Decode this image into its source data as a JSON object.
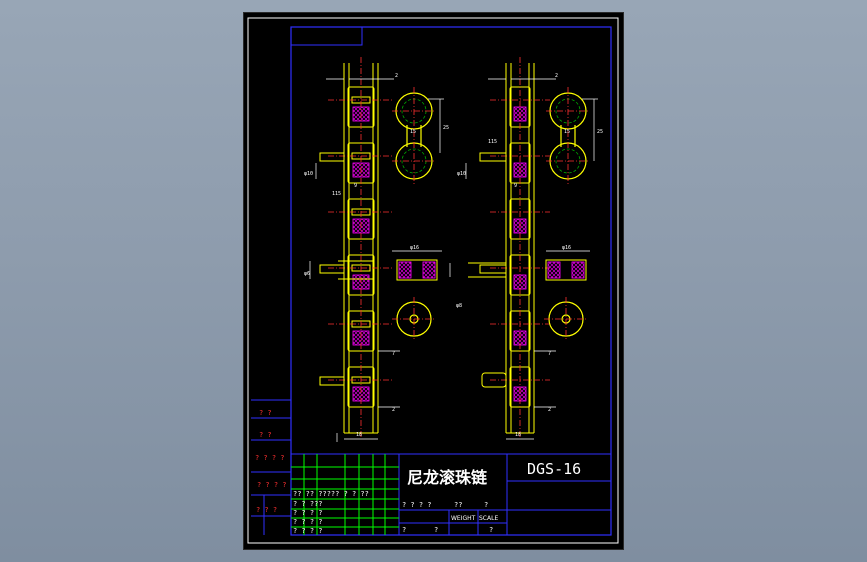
{
  "title_block": {
    "part_name": "尼龙滚珠链",
    "drawing_no": "DGS-16",
    "weight_label": "WEIGHT",
    "scale_label": "SCALE",
    "placeholder": "?"
  },
  "left_strip": {
    "cells": [
      "? ?",
      "? ?",
      "? ? ? ?",
      "? ? ? ?",
      "? ? ?"
    ]
  },
  "grid_rows": [
    "?? ?? ????? ? ? ??",
    "? ? ???",
    "? ? ? ?",
    "? ? ? ?",
    "? ? ? ?"
  ],
  "mid_row": [
    "? ? ? ?",
    "??",
    "?"
  ],
  "dims": {
    "d2": "2",
    "d7": "7",
    "d9": "9",
    "d18": "18",
    "d15": "15",
    "d25": "25",
    "d16": "φ16",
    "d6": "φ6",
    "d10": "φ10",
    "d115": "115",
    "d8": "φ8"
  },
  "colors": {
    "frame": "#0000ff",
    "border": "#ffffff",
    "part": "#ffff00",
    "center": "#ff0000",
    "dim": "#ffffff",
    "hidden": "#00aa00",
    "text": "#ffffff",
    "bg": "#000000"
  }
}
